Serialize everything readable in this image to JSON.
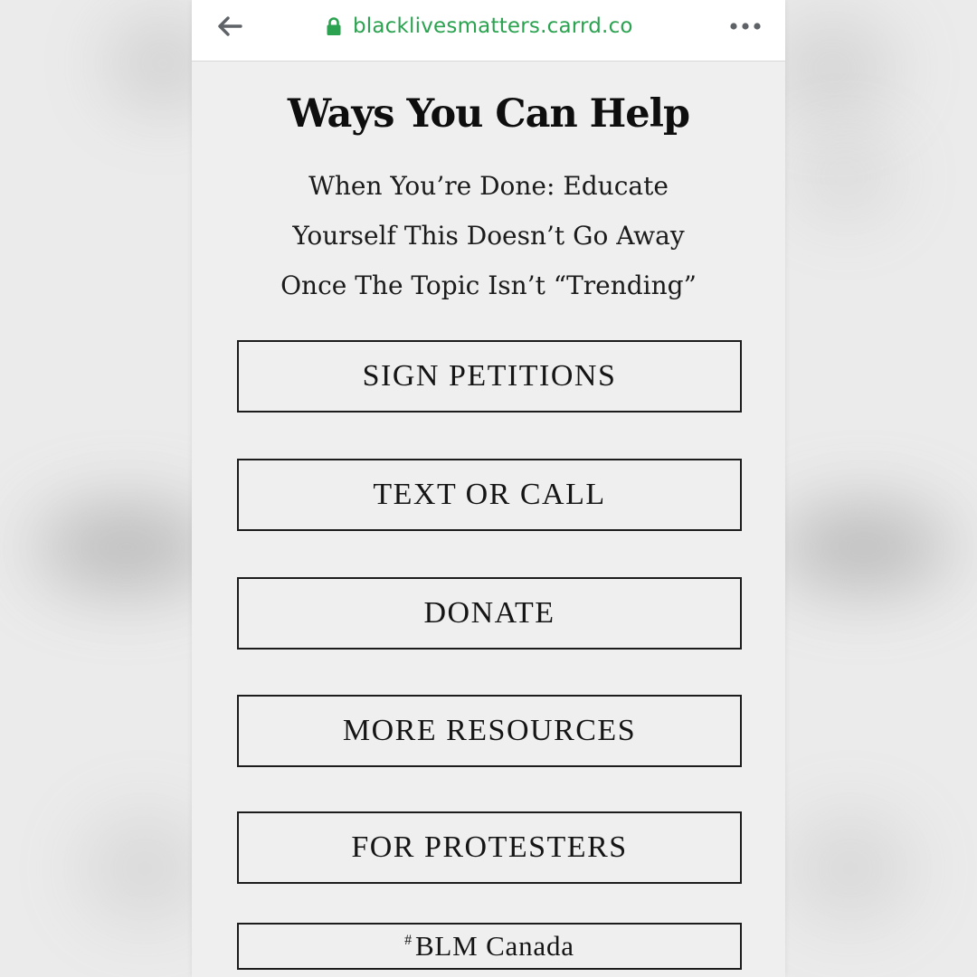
{
  "browser": {
    "url": "blacklivesmatters.carrd.co",
    "accent_color": "#2aa24f",
    "icons": [
      "back-arrow-icon",
      "lock-icon",
      "more-options-icon"
    ]
  },
  "page": {
    "title": "Ways You Can Help",
    "subtitle_lines": [
      "When You’re Done: Educate",
      "Yourself This Doesn’t Go Away",
      "Once The Topic Isn’t “Trending”"
    ],
    "buttons": [
      {
        "label": "SIGN PETITIONS"
      },
      {
        "label": "TEXT OR CALL"
      },
      {
        "label": "DONATE"
      },
      {
        "label": "MORE RESOURCES"
      },
      {
        "label": "FOR PROTESTERS"
      }
    ],
    "canada_button": {
      "hash": "#",
      "label": "BLM Canada"
    }
  }
}
